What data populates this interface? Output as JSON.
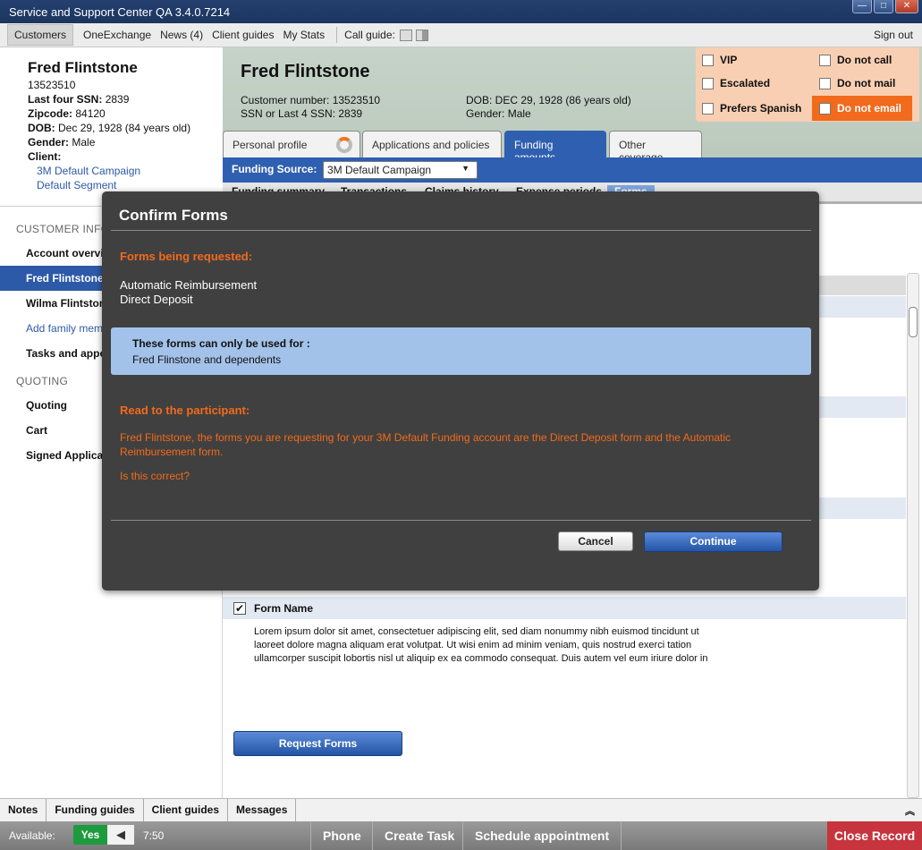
{
  "window": {
    "title": "Service and Support Center QA 3.4.0.7214",
    "buttons": {
      "minimize": "—",
      "maximize": "□",
      "close": "✕"
    }
  },
  "menu": {
    "items": [
      "Customers",
      "OneExchange",
      "News (4)",
      "Client guides",
      "My Stats"
    ],
    "call_guide": "Call guide:",
    "sign_out": "Sign out"
  },
  "customer_card": {
    "name": "Fred Flintstone",
    "id": "13523510",
    "last_four_label": "Last four SSN:",
    "last_four": "2839",
    "zip_label": "Zipcode:",
    "zip": "84120",
    "dob_label": "DOB:",
    "dob": "Dec 29, 1928 (84 years old)",
    "gender_label": "Gender:",
    "gender": "Male",
    "client_label": "Client:",
    "client_links": [
      "3M Default Campaign",
      "Default Segment"
    ]
  },
  "leftnav": {
    "section1": "CUSTOMER INFO",
    "items1": [
      "Account overview",
      "Fred Flintstone",
      "Wilma Flintstone",
      "Add family member",
      "Tasks and appointments"
    ],
    "section2": "QUOTING",
    "items2": [
      "Quoting",
      "Cart",
      "Signed Applications"
    ]
  },
  "header": {
    "name": "Fred Flintstone",
    "customer_number": "Customer number: 13523510",
    "ssn": "SSN or Last 4 SSN: 2839",
    "dob": "DOB: DEC 29, 1928 (86 years old)",
    "gender": "Gender: Male"
  },
  "flags": {
    "vip": "VIP",
    "escalated": "Escalated",
    "spanish": "Prefers Spanish",
    "no_call": "Do not call",
    "no_mail": "Do not mail",
    "no_email": "Do not email"
  },
  "tabs": [
    "Personal profile",
    "Applications and policies",
    "Funding amounts",
    "Other coverage"
  ],
  "funding": {
    "label": "Funding Source:",
    "selected": "3M Default Campaign"
  },
  "subtabs": [
    "Funding summary",
    "Transactions",
    "Claims history",
    "Expense periods",
    "Forms"
  ],
  "form_item": {
    "name": "Form Name",
    "description": "Lorem ipsum dolor sit amet, consectetuer adipiscing elit, sed diam nonummy nibh euismod tincidunt ut laoreet dolore magna aliquam erat volutpat. Ut wisi enim ad minim veniam, quis nostrud exerci tation ullamcorper suscipit lobortis nisl ut aliquip ex ea commodo consequat. Duis autem vel eum iriure dolor in"
  },
  "request_button": "Request Forms",
  "bottom_tabs": [
    "Notes",
    "Funding guides",
    "Client guides",
    "Messages"
  ],
  "status": {
    "available": "Available:",
    "yes": "Yes",
    "timer": "7:50",
    "buttons": [
      "Phone",
      "Create Task",
      "Schedule appointment"
    ],
    "close_record": "Close Record"
  },
  "modal": {
    "title": "Confirm Forms",
    "requested_heading": "Forms being requested:",
    "forms": [
      "Automatic Reimbursement",
      "Direct Deposit"
    ],
    "info_heading": "These forms can only be used for :",
    "info_text": "Fred Flinstone and dependents",
    "read_heading": "Read to the participant:",
    "script": "Fred Flintstone, the forms you are requesting for your 3M Default Funding account are the Direct Deposit form and the Automatic Reimbursement form.",
    "question": "Is this correct?",
    "cancel": "Cancel",
    "continue": "Continue"
  },
  "colors": {
    "accent": "#2f5fb0",
    "warning": "#f26a1b",
    "flag_bg": "#f8cfb2",
    "close_record": "#c7343d"
  }
}
